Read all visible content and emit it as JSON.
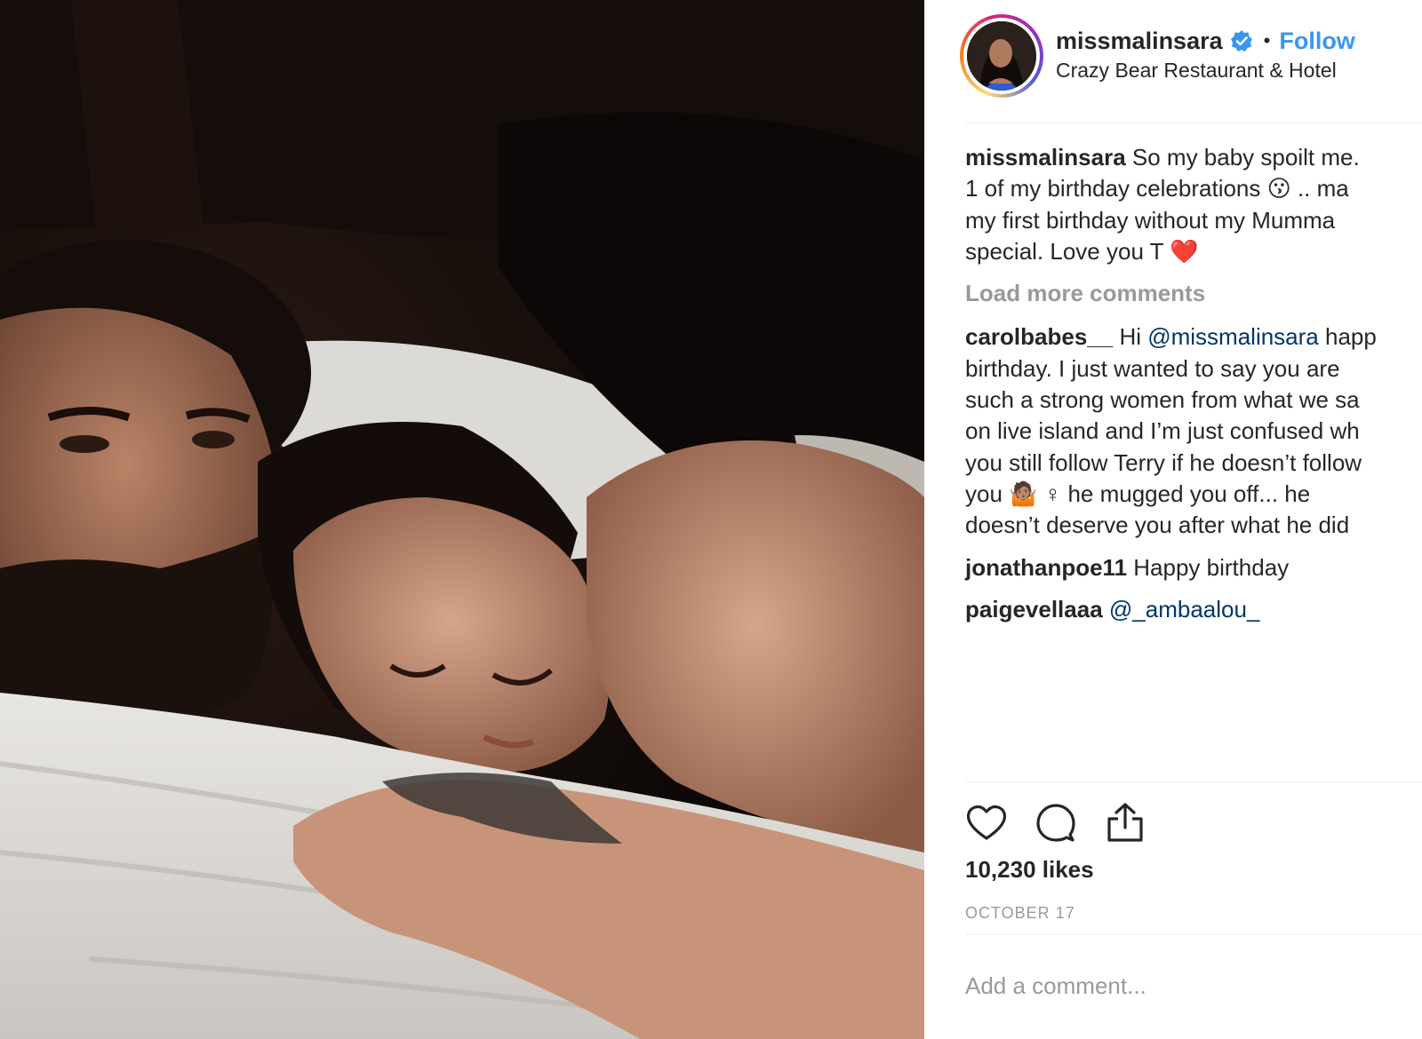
{
  "post": {
    "username": "missmalinsara",
    "follow_label": "Follow",
    "separator": "•",
    "location": "Crazy Bear Restaurant & Hotel",
    "verified": true
  },
  "caption": {
    "username": "missmalinsara",
    "lines": [
      " So my baby spoilt me.",
      "1 of my birthday celebrations 😗 .. ma",
      "my first birthday without my Mumma",
      "special. Love you T ❤️"
    ]
  },
  "load_more_label": "Load more comments",
  "comments": [
    {
      "username": "carolbabes__",
      "before_mention": " Hi ",
      "mention": "@missmalinsara",
      "after_mention": " happ",
      "lines": [
        "birthday. I just wanted to say you are",
        "such a strong women from what we sa",
        "on live island and I’m just confused wh",
        "you still follow Terry if he doesn’t follow",
        "you 🤷🏽 ♀ he mugged you off... he",
        "doesn’t deserve you after what he did"
      ]
    },
    {
      "username": "jonathanpoe11",
      "text": " Happy birthday"
    },
    {
      "username": "paigevellaaa",
      "mention": "@_ambaalou_"
    }
  ],
  "actions": {
    "like_icon": "heart-icon",
    "comment_icon": "comment-bubble-icon",
    "share_icon": "share-icon"
  },
  "likes_label": "10,230 likes",
  "date_label": "OCTOBER 17",
  "add_comment_placeholder": "Add a comment...",
  "colors": {
    "follow": "#3897f0",
    "mention": "#003569",
    "muted": "#999999",
    "verified_badge": "#3897f0"
  }
}
